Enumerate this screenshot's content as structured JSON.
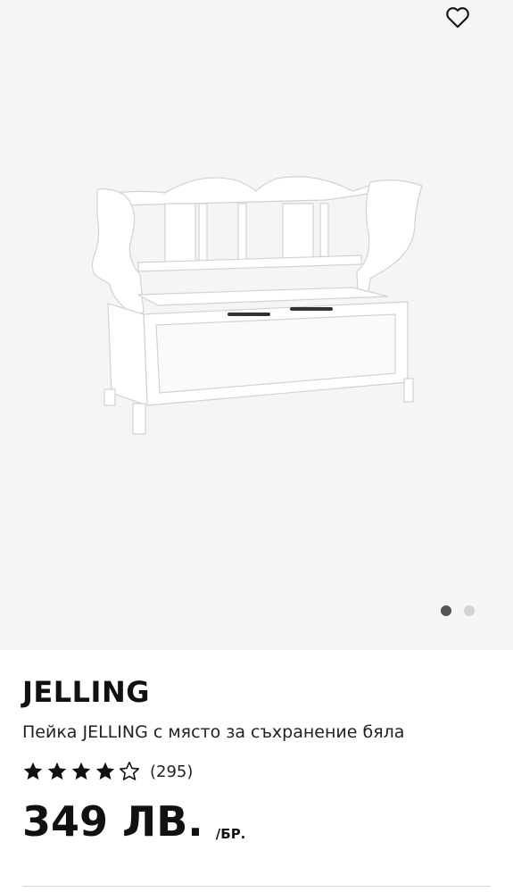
{
  "product": {
    "brand": "JELLING",
    "description": "Пейка JELLING с място за съхранение бяла",
    "rating": {
      "value": 4,
      "max": 5,
      "count": "(295)"
    },
    "price": {
      "amount": "349 ЛВ.",
      "unit": "/БР."
    }
  },
  "gallery": {
    "total_images": 2,
    "active_index": 0
  },
  "icons": {
    "favorite": "heart-icon"
  },
  "colors": {
    "image_background": "#f5f5f5",
    "text": "#111111",
    "dot_active": "#555555",
    "dot_inactive": "#d3d3d3"
  }
}
